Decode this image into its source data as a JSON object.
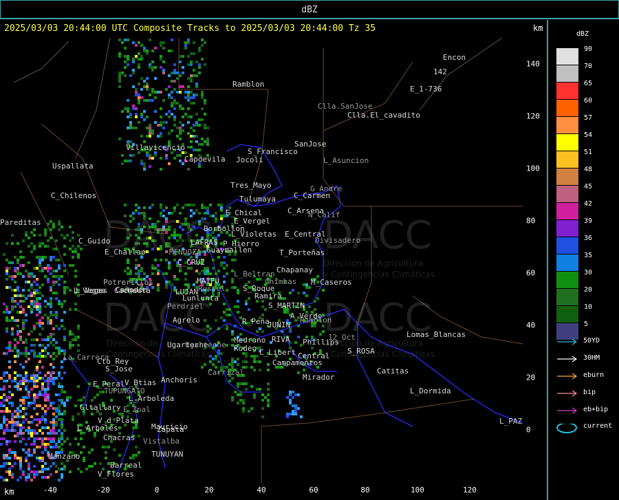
{
  "window": {
    "title": "dBZ"
  },
  "header": {
    "text": "2025/03/03 20:44:00 UTC Composite Tracks to 2025/03/03 20:44:00 Tz 35",
    "km_top": "km",
    "km_bottom": "km"
  },
  "axes": {
    "x_ticks": [
      "-40",
      "-20",
      "0",
      "20",
      "40",
      "60",
      "80",
      "100",
      "120"
    ],
    "y_ticks": [
      "140",
      "120",
      "100",
      "80",
      "60",
      "40",
      "20",
      "0"
    ]
  },
  "watermark": {
    "brand": "DACC",
    "line1": "Dirección de Agricultura",
    "line2": "y Contingencias Climáticas",
    "line1_alt": "Dirección de",
    "line2_alt": "Contingencias Climáticas"
  },
  "places": [
    "Ramblon",
    "Encon",
    "E_1-736",
    "142",
    "Clla.SanJose",
    "Clla.El_cavadito",
    "S_Francisco",
    "Jocoli",
    "SanJose",
    "L_Asuncion",
    "Uspallata",
    "Capdevila",
    "Villavicencio",
    "Tres_Mayo",
    "G_Andre",
    "Tulumaya",
    "C_Carmen",
    "C_Chilenos",
    "C_Arsena",
    "N_Calif",
    "E_Chical",
    "E_Vergel",
    "Borbollon",
    "E_Central",
    "Divisadero",
    "L_Violetas",
    "P_Hierro",
    "C_Guido",
    "E_Challao",
    "MENDOZA",
    "LAFRAS",
    "Guaymallen",
    "T_Porteñas",
    "C_CRUZ",
    "L_Beltran",
    "Chapanay",
    "Potrerillos",
    "MAIPU",
    "Cañadon",
    "Chimbas",
    "M_Caseros",
    "L_Vegas",
    "Cacheuta",
    "LUJAN",
    "Russel",
    "S_Roque",
    "Ramira",
    "Lunlunta",
    "S_MARTIN",
    "Perdriel",
    "A_Verde",
    "Agrelo",
    "R_Peña",
    "JUNIN",
    "Ramblon",
    "Lomas_Blancas",
    "Medrano",
    "RIVA",
    "Phillips",
    "12_Oct",
    "Ugarteche",
    "Rodeo",
    "C_Libert",
    "S_ROSA",
    "La_Carrera",
    "Cto_Rey",
    "Central",
    "Campamentos",
    "S_Jose",
    "Carrizal",
    "Mirador",
    "Catitas",
    "E_Peral",
    "V_Btias",
    "TUPUNGATO",
    "Anchoris",
    "L_Arboleda",
    "L_Dormida",
    "Gltallary",
    "E_Zpal",
    "V_d_Plata",
    "Zapata",
    "L_PAZ",
    "L_Arboles",
    "Vistalba",
    "Manzano",
    "Chacras",
    "TUNUYAN",
    "V_Flores",
    "Ugarteche",
    "Mauricio",
    "Barreal",
    "Pareditas",
    "L_Vegas",
    "Potrerillos"
  ],
  "legend": {
    "title": "dBZ",
    "scale": [
      {
        "label": "90",
        "color": "#e0e0e0"
      },
      {
        "label": "70",
        "color": "#c0c0c0"
      },
      {
        "label": "65",
        "color": "#ff3030"
      },
      {
        "label": "60",
        "color": "#ff6000"
      },
      {
        "label": "57",
        "color": "#ff9040"
      },
      {
        "label": "54",
        "color": "#ffff00"
      },
      {
        "label": "51",
        "color": "#ffc020"
      },
      {
        "label": "48",
        "color": "#d08040"
      },
      {
        "label": "45",
        "color": "#c06080"
      },
      {
        "label": "42",
        "color": "#d020a0"
      },
      {
        "label": "39",
        "color": "#8020d0"
      },
      {
        "label": "36",
        "color": "#2050e0"
      },
      {
        "label": "35",
        "color": "#1080e0"
      },
      {
        "label": "30",
        "color": "#109010"
      },
      {
        "label": "20",
        "color": "#207020"
      },
      {
        "label": "10",
        "color": "#106010"
      },
      {
        "label": "5",
        "color": "#404080"
      }
    ],
    "tracks": [
      {
        "label": "50YD",
        "color": "#30c0d0"
      },
      {
        "label": "30HM",
        "color": "#ffffff"
      },
      {
        "label": "eburn",
        "color": "#ffb040"
      },
      {
        "label": "bip",
        "color": "#ff9090"
      },
      {
        "label": "eb+bip",
        "color": "#d040d0"
      },
      {
        "label": "current",
        "color": "#20c0e0"
      }
    ]
  }
}
